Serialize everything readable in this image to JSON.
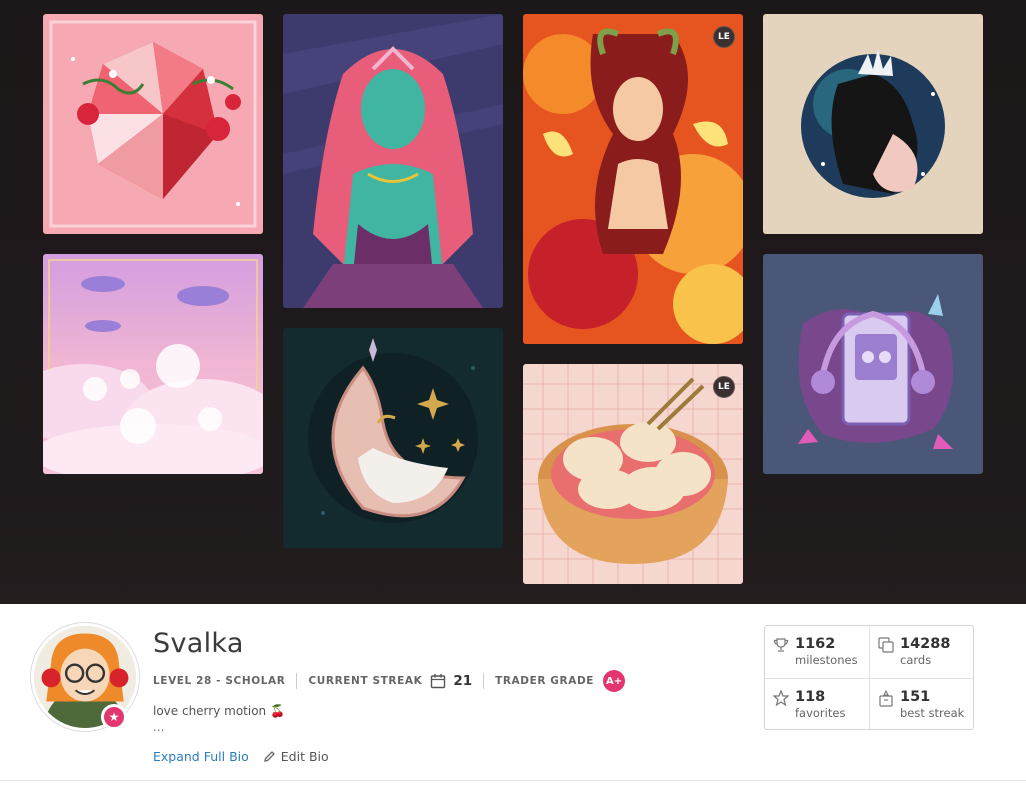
{
  "gallery": {
    "cards": [
      {
        "name": "crystal-strawberries"
      },
      {
        "name": "cloud-bunnies"
      },
      {
        "name": "sea-goddess"
      },
      {
        "name": "moon-potion"
      },
      {
        "name": "fire-warrior",
        "badge": "LE"
      },
      {
        "name": "bunny-dumplings",
        "badge": "LE"
      },
      {
        "name": "ice-queen-orb"
      },
      {
        "name": "cassette-player"
      }
    ]
  },
  "profile": {
    "username": "Svalka",
    "level_label": "LEVEL 28 - SCHOLAR",
    "streak_label": "CURRENT STREAK",
    "streak_value": "21",
    "grade_label": "TRADER GRADE",
    "grade_value": "A+",
    "bio": "love cherry motion 🍒",
    "bio_more": "...",
    "expand_link": "Expand Full Bio",
    "edit_link": "Edit Bio",
    "accent_color": "#e3366f",
    "link_color": "#2a7dc1"
  },
  "stats": {
    "milestones": {
      "value": "1162",
      "label": "milestones",
      "icon": "trophy-icon"
    },
    "cards": {
      "value": "14288",
      "label": "cards",
      "icon": "cards-icon"
    },
    "favorites": {
      "value": "118",
      "label": "favorites",
      "icon": "star-icon"
    },
    "best_streak": {
      "value": "151",
      "label": "best streak",
      "icon": "streak-icon"
    }
  }
}
